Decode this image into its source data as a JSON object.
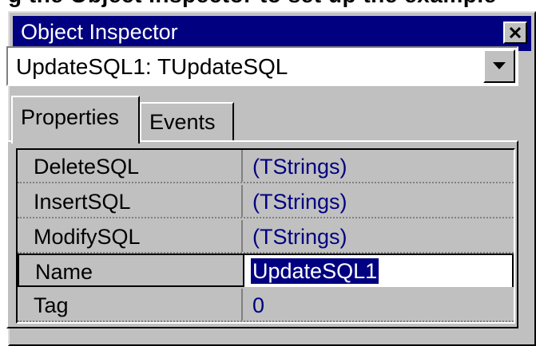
{
  "clipped_header": {
    "text": "g the Object Inspector to set up the example"
  },
  "window": {
    "title": "Object Inspector"
  },
  "combo": {
    "value": "UpdateSQL1: TUpdateSQL"
  },
  "tabs": [
    {
      "label": "Properties",
      "active": true
    },
    {
      "label": "Events",
      "active": false
    }
  ],
  "properties": [
    {
      "name": "DeleteSQL",
      "value": "(TStrings)"
    },
    {
      "name": "InsertSQL",
      "value": "(TStrings)"
    },
    {
      "name": "ModifySQL",
      "value": "(TStrings)"
    },
    {
      "name": "Name",
      "value": "UpdateSQL1"
    },
    {
      "name": "Tag",
      "value": "0"
    }
  ],
  "colors": {
    "titlebar": "#000080",
    "face": "#c0c0c0",
    "value_text": "#000080",
    "selection": "#000080"
  }
}
